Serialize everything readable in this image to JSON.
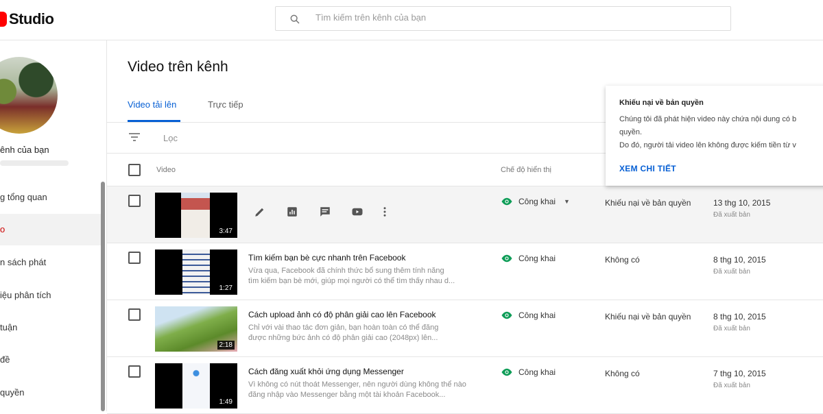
{
  "app": {
    "brand": "Studio"
  },
  "search": {
    "placeholder": "Tìm kiếm trên kênh của bạn"
  },
  "sidebar": {
    "channel_name": "ênh của bạn",
    "items": [
      {
        "label": "g tổng quan"
      },
      {
        "label": "o",
        "active": true
      },
      {
        "label": "n sách phát"
      },
      {
        "label": "iệu phân tích"
      },
      {
        "label": "tuận"
      },
      {
        "label": "đề"
      },
      {
        "label": "quyền"
      }
    ]
  },
  "main": {
    "title": "Video trên kênh",
    "tabs": [
      {
        "label": "Video tải lên"
      },
      {
        "label": "Trực tiếp"
      }
    ],
    "filter_label": "Lọc",
    "columns": {
      "video": "Video",
      "visibility": "Chế độ hiển thị"
    }
  },
  "popup": {
    "title": "Khiếu nại về bản quyền",
    "body_1": "Chúng tôi đã phát hiện video này chứa nội dung có b",
    "body_2": "quyền.",
    "body_3": "Do đó, người tải video lên không được kiếm tiền từ v",
    "link": "XEM CHI TIẾT"
  },
  "rows": [
    {
      "title": "",
      "desc_1": "",
      "desc_2": "",
      "duration": "3:47",
      "visibility": "Công khai",
      "restriction": "Khiếu nại về bản quyền",
      "date": "13 thg 10, 2015",
      "status": "Đã xuất bản"
    },
    {
      "title": "Tìm kiếm bạn bè cực nhanh trên Facebook",
      "desc_1": "Vừa qua, Facebook đã chính thức bổ sung thêm tính năng",
      "desc_2": "tìm kiếm bạn bè mới, giúp mọi người có thể tìm thấy nhau d...",
      "duration": "1:27",
      "visibility": "Công khai",
      "restriction": "Không có",
      "date": "8 thg 10, 2015",
      "status": "Đã xuất bản"
    },
    {
      "title": "Cách upload ảnh có độ phân giải cao lên Facebook",
      "desc_1": "Chỉ với vài thao tác đơn giản, bạn hoàn toàn có thể đăng",
      "desc_2": "được những bức ảnh có độ phân giải cao (2048px) lên...",
      "duration": "2:18",
      "visibility": "Công khai",
      "restriction": "Khiếu nại về bản quyền",
      "date": "8 thg 10, 2015",
      "status": "Đã xuất bản"
    },
    {
      "title": "Cách đăng xuất khỏi ứng dụng Messenger",
      "desc_1": "Vì không có nút thoát Messenger, nên người dùng không thể nào",
      "desc_2": "đăng nhập vào Messenger bằng một tài khoản Facebook...",
      "duration": "1:49",
      "visibility": "Công khai",
      "restriction": "Không có",
      "date": "7 thg 10, 2015",
      "status": "Đã xuất bản"
    }
  ],
  "colors": {
    "accent": "#065fd4",
    "brand_red": "#ff0000",
    "visibility_green": "#0f9d58"
  }
}
